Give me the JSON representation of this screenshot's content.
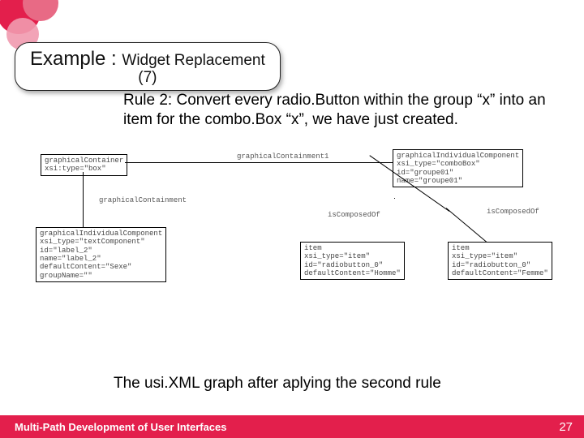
{
  "title": {
    "main": "Example : ",
    "sub": "Widget Replacement",
    "line2": "(7)"
  },
  "rule_text": "Rule 2: Convert every radio.Button within the group “x” into an item for the combo.Box “x”, we have just created.",
  "diagram": {
    "box_container": "graphicalContainer\nxsi:type=\"box\"",
    "label_containment_top": "graphicalContainment1",
    "label_containment_left": "graphicalContainment",
    "box_combo": "graphicalIndividualComponent\nxsi_type=\"comboBox\"\nid=\"groupe01\"\nname=\"groupe01\"",
    "box_textcomp": "graphicalIndividualComponent\nxsi_type=\"textComponent\"\nid=\"label_2\"\nname=\"label_2\"\ndefaultContent=\"Sexe\"\ngroupName=\"\"",
    "label_iscomposed": "isComposedOf",
    "label_iscomposed2": "isComposedOf",
    "box_item1": "item\nxsi_type=\"item\"\nid=\"radiobutton_0\"\ndefaultContent=\"Homme\"",
    "box_item2": "item\nxsi_type=\"item\"\nid=\"radiobutton_0\"\ndefaultContent=\"Femme\""
  },
  "caption": "The usi.XML graph after aplying the second rule",
  "footer": {
    "left": "Multi-Path Development of User Interfaces",
    "page": "27"
  }
}
